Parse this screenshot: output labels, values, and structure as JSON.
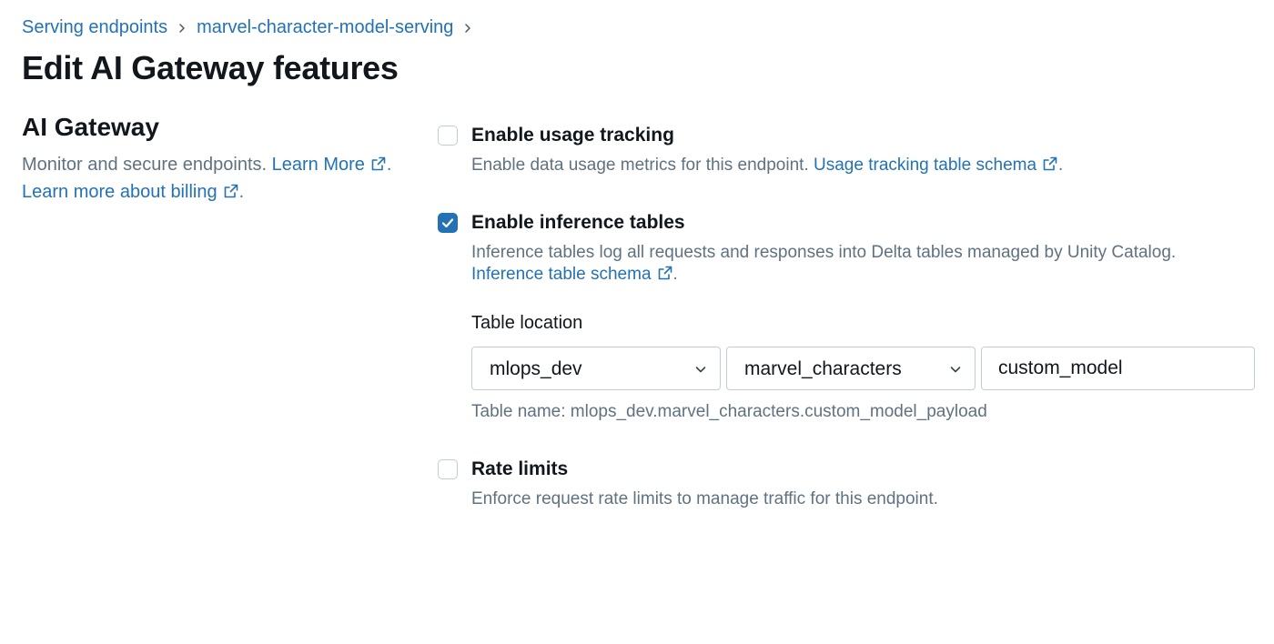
{
  "breadcrumb": {
    "items": [
      {
        "label": "Serving endpoints"
      },
      {
        "label": "marvel-character-model-serving"
      }
    ]
  },
  "page": {
    "title": "Edit AI Gateway features"
  },
  "section": {
    "title": "AI Gateway",
    "desc_text": "Monitor and secure endpoints.",
    "learn_more_link": "Learn More",
    "billing_link": "Learn more about billing",
    "period": "."
  },
  "options": {
    "usage_tracking": {
      "checked": false,
      "label": "Enable usage tracking",
      "desc": "Enable data usage metrics for this endpoint.",
      "link": "Usage tracking table schema"
    },
    "inference_tables": {
      "checked": true,
      "label": "Enable inference tables",
      "desc": "Inference tables log all requests and responses into Delta tables managed by Unity Catalog.",
      "link": "Inference table schema"
    },
    "rate_limits": {
      "checked": false,
      "label": "Rate limits",
      "desc": "Enforce request rate limits to manage traffic for this endpoint."
    }
  },
  "table_location": {
    "label": "Table location",
    "catalog": "mlops_dev",
    "schema": "marvel_characters",
    "table_prefix": "custom_model",
    "table_name_text": "Table name: mlops_dev.marvel_characters.custom_model_payload"
  },
  "colors": {
    "link": "#2272b4",
    "checkbox_checked": "#2272b4",
    "muted_text": "#5f7281",
    "border": "#c0cdd8"
  },
  "icons": {
    "external": "external-link-icon",
    "chevron_right": "chevron-right-icon",
    "chevron_down": "chevron-down-icon",
    "check": "check-icon"
  }
}
